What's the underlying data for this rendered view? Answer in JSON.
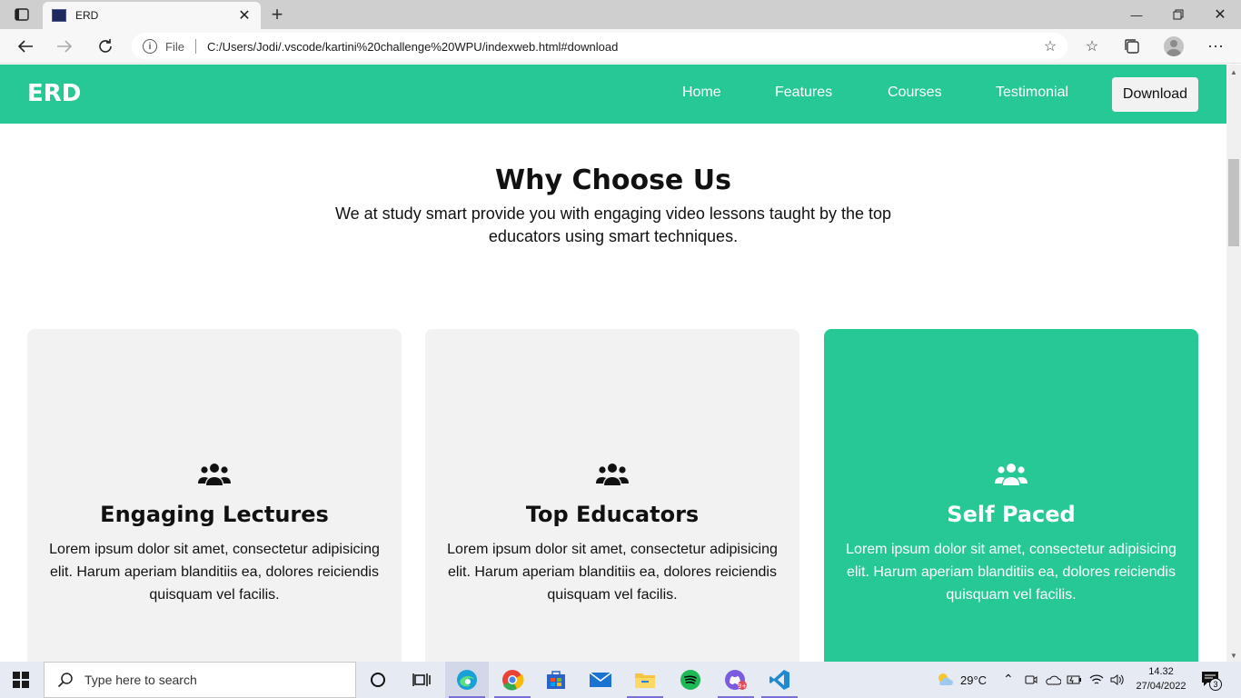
{
  "browser": {
    "tab_title": "ERD",
    "address_prefix": "File",
    "url": "C:/Users/Jodi/.vscode/kartini%20challenge%20WPU/indexweb.html#download"
  },
  "site": {
    "brand": "ERD",
    "nav": {
      "home": "Home",
      "features": "Features",
      "courses": "Courses",
      "testimonial": "Testimonial",
      "download": "Download"
    },
    "section": {
      "title": "Why Choose Us",
      "subtitle": "We at study smart provide you with engaging video lessons taught by the top educators using smart techniques."
    },
    "cards": [
      {
        "title": "Engaging Lectures",
        "text": "Lorem ipsum dolor sit amet, consectetur adipisicing elit. Harum aperiam blanditiis ea, dolores reiciendis quisquam vel facilis.",
        "icon": "users-icon"
      },
      {
        "title": "Top Educators",
        "text": "Lorem ipsum dolor sit amet, consectetur adipisicing elit. Harum aperiam blanditiis ea, dolores reiciendis quisquam vel facilis.",
        "icon": "users-icon"
      },
      {
        "title": "Self Paced",
        "text": "Lorem ipsum dolor sit amet, consectetur adipisicing elit. Harum aperiam blanditiis ea, dolores reiciendis quisquam vel facilis.",
        "icon": "users-icon"
      }
    ]
  },
  "colors": {
    "brand_green": "#26c995",
    "card_gray": "#f2f2f2"
  },
  "taskbar": {
    "search_placeholder": "Type here to search",
    "temperature": "29°C",
    "time": "14.32",
    "date": "27/04/2022",
    "notification_count": "3"
  }
}
